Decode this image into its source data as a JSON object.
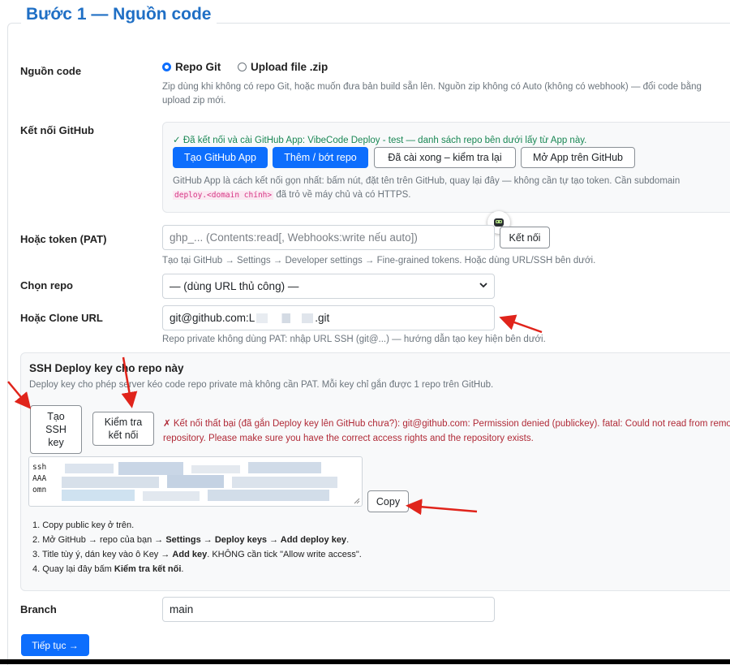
{
  "legend": "Bước 1 — Nguồn code",
  "source": {
    "label": "Nguồn code",
    "option_git": "Repo Git",
    "option_zip": "Upload file .zip",
    "help": "Zip dùng khi không có repo Git, hoặc muốn đưa bản build sẵn lên. Nguồn zip không có Auto (không có webhook) — đổi code bằng",
    "help2": "upload zip mới."
  },
  "github": {
    "label": "Kết nối GitHub",
    "status": "✓ Đã kết nối và cài GitHub App: VibeCode Deploy - test — danh sách repo bên dưới lấy từ App này.",
    "btn_create": "Tạo GitHub App",
    "btn_addrepo": "Thêm / bớt repo",
    "btn_check": "Đã cài xong – kiểm tra lại",
    "btn_open": "Mở App trên GitHub",
    "help1": "GitHub App là cách kết nối gọn nhất: bấm nút, đặt tên trên GitHub, quay lại đây — không cần tự tạo token. Cần subdomain",
    "help_code": "deploy.<domain chính>",
    "help2": "đã trỏ về máy chủ và có HTTPS."
  },
  "token": {
    "label": "Hoặc token (PAT)",
    "placeholder": "ghp_... (Contents:read[, Webhooks:write nếu auto])",
    "btn": "Kết nối",
    "help": "Tạo tại GitHub → Settings → Developer settings → Fine-grained tokens. Hoặc dùng URL/SSH bên dưới."
  },
  "repo": {
    "label": "Chọn repo",
    "selected": "— (dùng URL thủ công) —"
  },
  "clone": {
    "label": "Hoặc Clone URL",
    "value_prefix": "git@github.com:L",
    "value_suffix": ".git",
    "help": "Repo private không dùng PAT: nhập URL SSH (git@...) — hướng dẫn tạo key hiện bên dưới."
  },
  "ssh": {
    "title": "SSH Deploy key cho repo này",
    "desc": "Deploy key cho phép server kéo code repo private mà không cần PAT. Mỗi key chỉ gắn được 1 repo trên GitHub.",
    "btn_create_l1": "Tạo",
    "btn_create_l2": "SSH",
    "btn_create_l3": "key",
    "btn_check_l1": "Kiểm tra",
    "btn_check_l2": "kết nối",
    "error": "✗ Kết nối thất bại (đã gắn Deploy key lên GitHub chưa?): git@github.com: Permission denied (publickey). fatal: Could not read from remote repository. Please make sure you have the correct access rights and the repository exists.",
    "key_line1": "ssh",
    "key_line2": "AAA",
    "key_line3": "omn",
    "btn_copy": "Copy",
    "step1": "1. Copy public key ở trên.",
    "step2_a": "2. Mở GitHub → repo của bạn → ",
    "step2_b": "Settings → Deploy keys → Add deploy key",
    "step2_c": ".",
    "step3_a": "3. Title tùy ý, dán key vào ô Key → ",
    "step3_b": "Add key",
    "step3_c": ". KHÔNG cần tick \"Allow write access\".",
    "step4_a": "4. Quay lại đây bấm ",
    "step4_b": "Kiểm tra kết nối",
    "step4_c": "."
  },
  "branch": {
    "label": "Branch",
    "value": "main"
  },
  "continue_btn": "Tiếp tục →",
  "colors": {
    "primary": "#0d6efd",
    "heading": "#1f6fc5",
    "success": "#198754",
    "danger": "#b02a37",
    "annotation": "#e0241b"
  }
}
